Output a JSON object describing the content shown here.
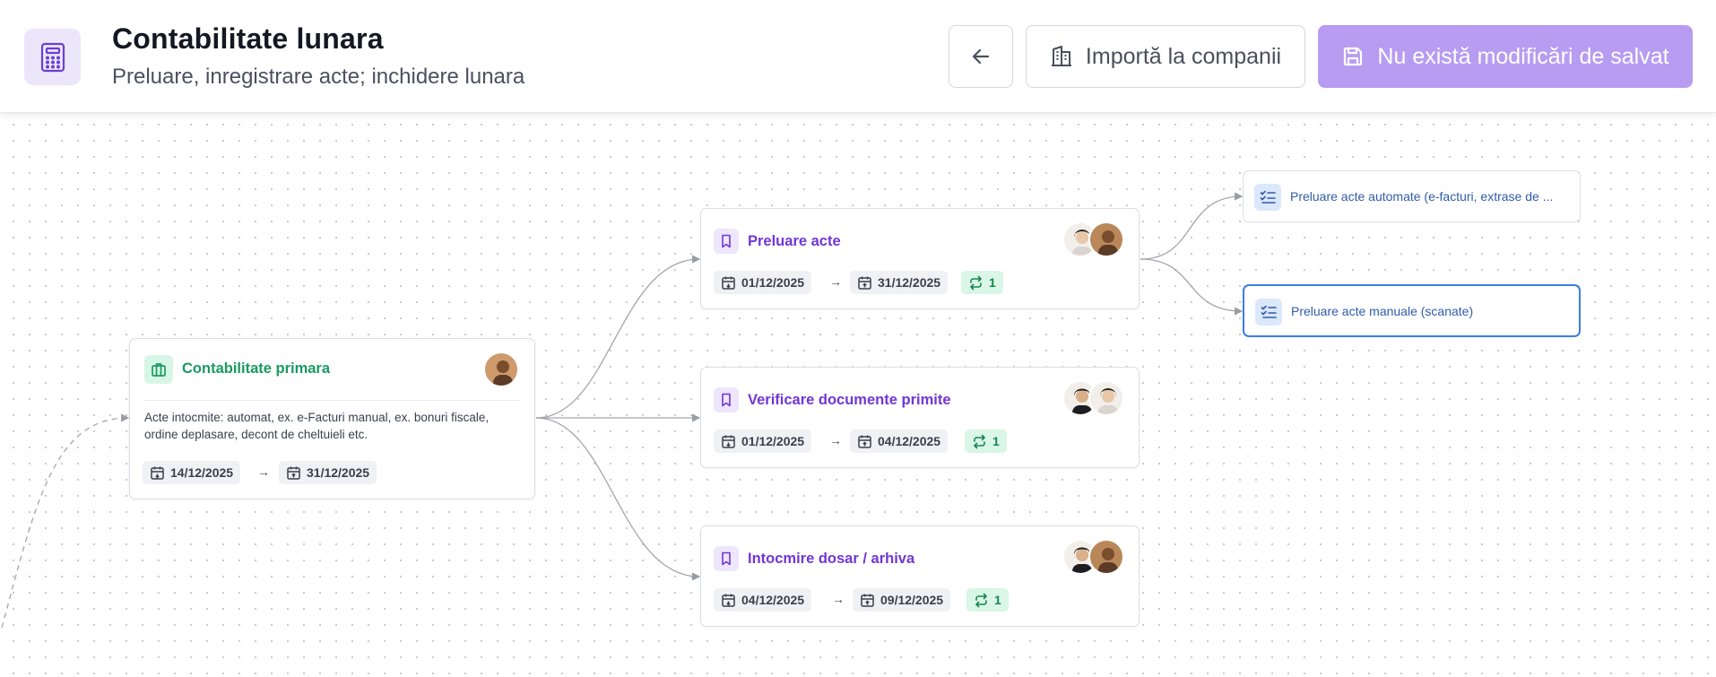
{
  "header": {
    "title": "Contabilitate lunara",
    "subtitle": "Preluare, inregistrare acte; inchidere lunara",
    "import_label": "Importă la companii",
    "save_label": "Nu există modificări de salvat"
  },
  "colors": {
    "accent": "#7136d6",
    "accent_light": "#b79cf1",
    "green": "#199a62",
    "selected_border": "#3c7ee0"
  },
  "nodes": {
    "primary": {
      "title": "Contabilitate primara",
      "description": "Acte intocmite: automat, ex. e-Facturi manual, ex. bonuri fiscale, ordine deplasare, decont de cheltuieli etc.",
      "start": "14/12/2025",
      "end": "31/12/2025"
    },
    "preluare": {
      "title": "Preluare acte",
      "start": "01/12/2025",
      "end": "31/12/2025",
      "repeat": "1"
    },
    "verificare": {
      "title": "Verificare documente primite",
      "start": "01/12/2025",
      "end": "04/12/2025",
      "repeat": "1"
    },
    "dosar": {
      "title": "Intocmire dosar / arhiva",
      "start": "04/12/2025",
      "end": "09/12/2025",
      "repeat": "1"
    },
    "checklists": [
      {
        "label": "Preluare acte automate (e-facturi, extrase de ..."
      },
      {
        "label": "Preluare acte manuale (scanate)"
      }
    ]
  },
  "arrow_symbol": "→"
}
